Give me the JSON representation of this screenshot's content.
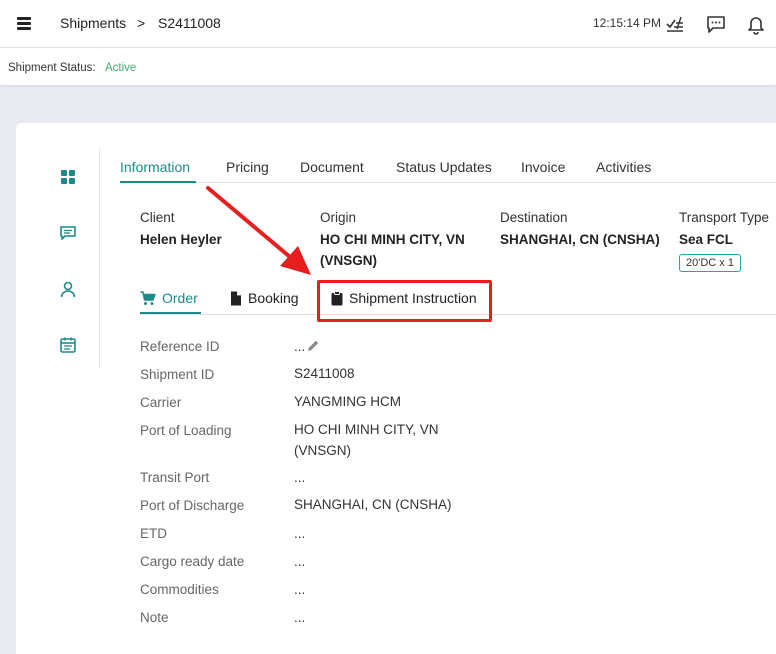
{
  "header": {
    "breadcrumb": [
      "Shipments",
      "S2411008"
    ],
    "separator": ">",
    "time": "12:15:14 PM"
  },
  "status": {
    "label": "Shipment Status:",
    "value": "Active",
    "color": "#3cb371"
  },
  "sidebar": [
    "dashboard-icon",
    "chat-icon",
    "user-icon",
    "calendar-icon"
  ],
  "tabs": [
    "Information",
    "Pricing",
    "Document",
    "Status Updates",
    "Invoice",
    "Activities"
  ],
  "info": {
    "client": {
      "label": "Client",
      "value": "Helen Heyler"
    },
    "origin": {
      "label": "Origin",
      "line1": "HO CHI MINH CITY, VN",
      "line2": "(VNSGN)"
    },
    "destination": {
      "label": "Destination",
      "value": "SHANGHAI, CN (CNSHA)"
    },
    "transport": {
      "label": "Transport Type",
      "value": "Sea FCL",
      "badge": "20'DC x 1"
    }
  },
  "subtabs": [
    "Order",
    "Booking",
    "Shipment Instruction"
  ],
  "fields": [
    {
      "label": "Reference ID",
      "value": "..."
    },
    {
      "label": "Shipment ID",
      "value": "S2411008"
    },
    {
      "label": "Carrier",
      "value": "YANGMING HCM"
    },
    {
      "label": "Port of Loading",
      "value": "HO CHI MINH CITY, VN",
      "value2": "(VNSGN)"
    },
    {
      "label": "Transit Port",
      "value": "..."
    },
    {
      "label": "Port of Discharge",
      "value": "SHANGHAI, CN (CNSHA)"
    },
    {
      "label": "ETD",
      "value": "..."
    },
    {
      "label": "Cargo ready date",
      "value": "..."
    },
    {
      "label": "Commodities",
      "value": "..."
    },
    {
      "label": "Note",
      "value": "..."
    }
  ],
  "colors": {
    "accent": "#1f8a8a",
    "annotation": "#e61e1e"
  }
}
